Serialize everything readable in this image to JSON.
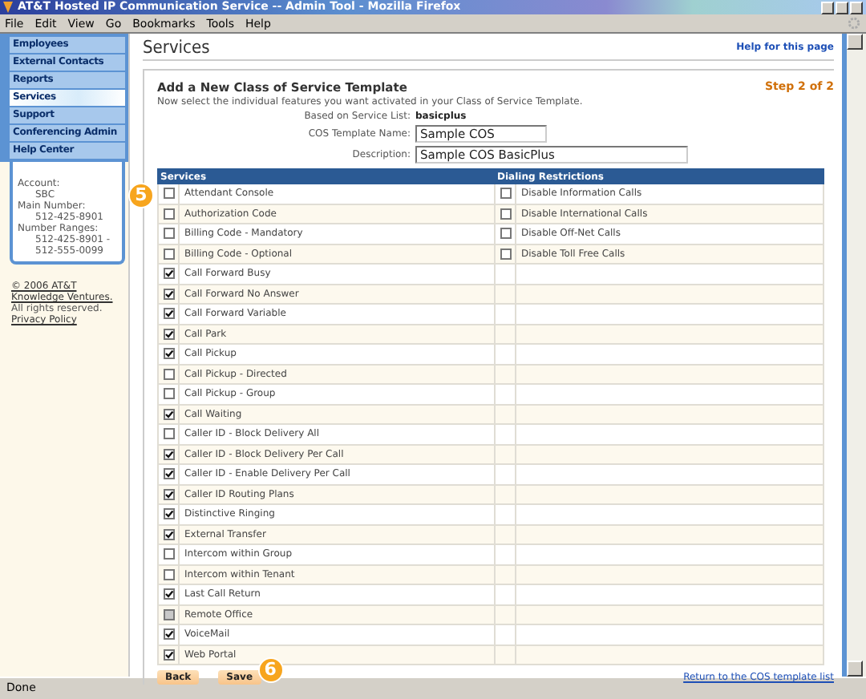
{
  "window": {
    "title": "AT&T Hosted IP Communication Service -- Admin Tool - Mozilla Firefox"
  },
  "menu": [
    "File",
    "Edit",
    "View",
    "Go",
    "Bookmarks",
    "Tools",
    "Help"
  ],
  "sidebar": {
    "items": [
      {
        "label": "Employees",
        "selected": false
      },
      {
        "label": "External Contacts",
        "selected": false
      },
      {
        "label": "Reports",
        "selected": false
      },
      {
        "label": "Services",
        "selected": true
      },
      {
        "label": "Support",
        "selected": false
      },
      {
        "label": "Conferencing Admin",
        "selected": false
      },
      {
        "label": "Help Center",
        "selected": false
      }
    ],
    "account": {
      "account_label": "Account:",
      "account": "SBC",
      "main_number_label": "Main Number:",
      "main_number": "512-425-8901",
      "ranges_label": "Number Ranges:",
      "range_start": "512-425-8901 -",
      "range_end": "512-555-0099"
    },
    "copyright": "© 2006 AT&T Knowledge Ventures.",
    "rights": "All rights reserved.",
    "privacy": "Privacy Policy"
  },
  "page": {
    "title": "Services",
    "help": "Help for this page"
  },
  "form": {
    "heading": "Add a New Class of Service Template",
    "step": "Step 2 of 2",
    "intro": "Now select the individual features you want activated in your Class of Service Template.",
    "based_on_label": "Based on Service List:",
    "based_on": "basicplus",
    "name_label": "COS Template Name:",
    "name_value": "Sample COS",
    "description_label": "Description:",
    "description_value": "Sample COS BasicPlus"
  },
  "table": {
    "columns": [
      "Services",
      "Dialing Restrictions"
    ],
    "services": [
      {
        "label": "Attendant Console",
        "checked": false,
        "disabled": false
      },
      {
        "label": "Authorization Code",
        "checked": false,
        "disabled": false
      },
      {
        "label": "Billing Code - Mandatory",
        "checked": false,
        "disabled": false
      },
      {
        "label": "Billing Code - Optional",
        "checked": false,
        "disabled": false
      },
      {
        "label": "Call Forward Busy",
        "checked": true,
        "disabled": false
      },
      {
        "label": "Call Forward No Answer",
        "checked": true,
        "disabled": false
      },
      {
        "label": "Call Forward Variable",
        "checked": true,
        "disabled": false
      },
      {
        "label": "Call Park",
        "checked": true,
        "disabled": false
      },
      {
        "label": "Call Pickup",
        "checked": true,
        "disabled": false
      },
      {
        "label": "Call Pickup - Directed",
        "checked": false,
        "disabled": false
      },
      {
        "label": "Call Pickup - Group",
        "checked": false,
        "disabled": false
      },
      {
        "label": "Call Waiting",
        "checked": true,
        "disabled": false
      },
      {
        "label": "Caller ID - Block Delivery All",
        "checked": false,
        "disabled": false
      },
      {
        "label": "Caller ID - Block Delivery Per Call",
        "checked": true,
        "disabled": false
      },
      {
        "label": "Caller ID - Enable Delivery Per Call",
        "checked": true,
        "disabled": false
      },
      {
        "label": "Caller ID Routing Plans",
        "checked": true,
        "disabled": false
      },
      {
        "label": "Distinctive Ringing",
        "checked": true,
        "disabled": false
      },
      {
        "label": "External Transfer",
        "checked": true,
        "disabled": false
      },
      {
        "label": "Intercom within Group",
        "checked": false,
        "disabled": false
      },
      {
        "label": "Intercom within Tenant",
        "checked": false,
        "disabled": false
      },
      {
        "label": "Last Call Return",
        "checked": true,
        "disabled": false
      },
      {
        "label": "Remote Office",
        "checked": false,
        "disabled": true
      },
      {
        "label": "VoiceMail",
        "checked": true,
        "disabled": false
      },
      {
        "label": "Web Portal",
        "checked": true,
        "disabled": false
      }
    ],
    "restrictions": [
      {
        "label": "Disable Information Calls",
        "checked": false
      },
      {
        "label": "Disable International Calls",
        "checked": false
      },
      {
        "label": "Disable Off-Net Calls",
        "checked": false
      },
      {
        "label": "Disable Toll Free Calls",
        "checked": false
      }
    ]
  },
  "buttons": [
    "Back",
    "Save"
  ],
  "return_link": "Return to the COS template list",
  "callouts": [
    "5",
    "6"
  ],
  "status_bar": "Done"
}
